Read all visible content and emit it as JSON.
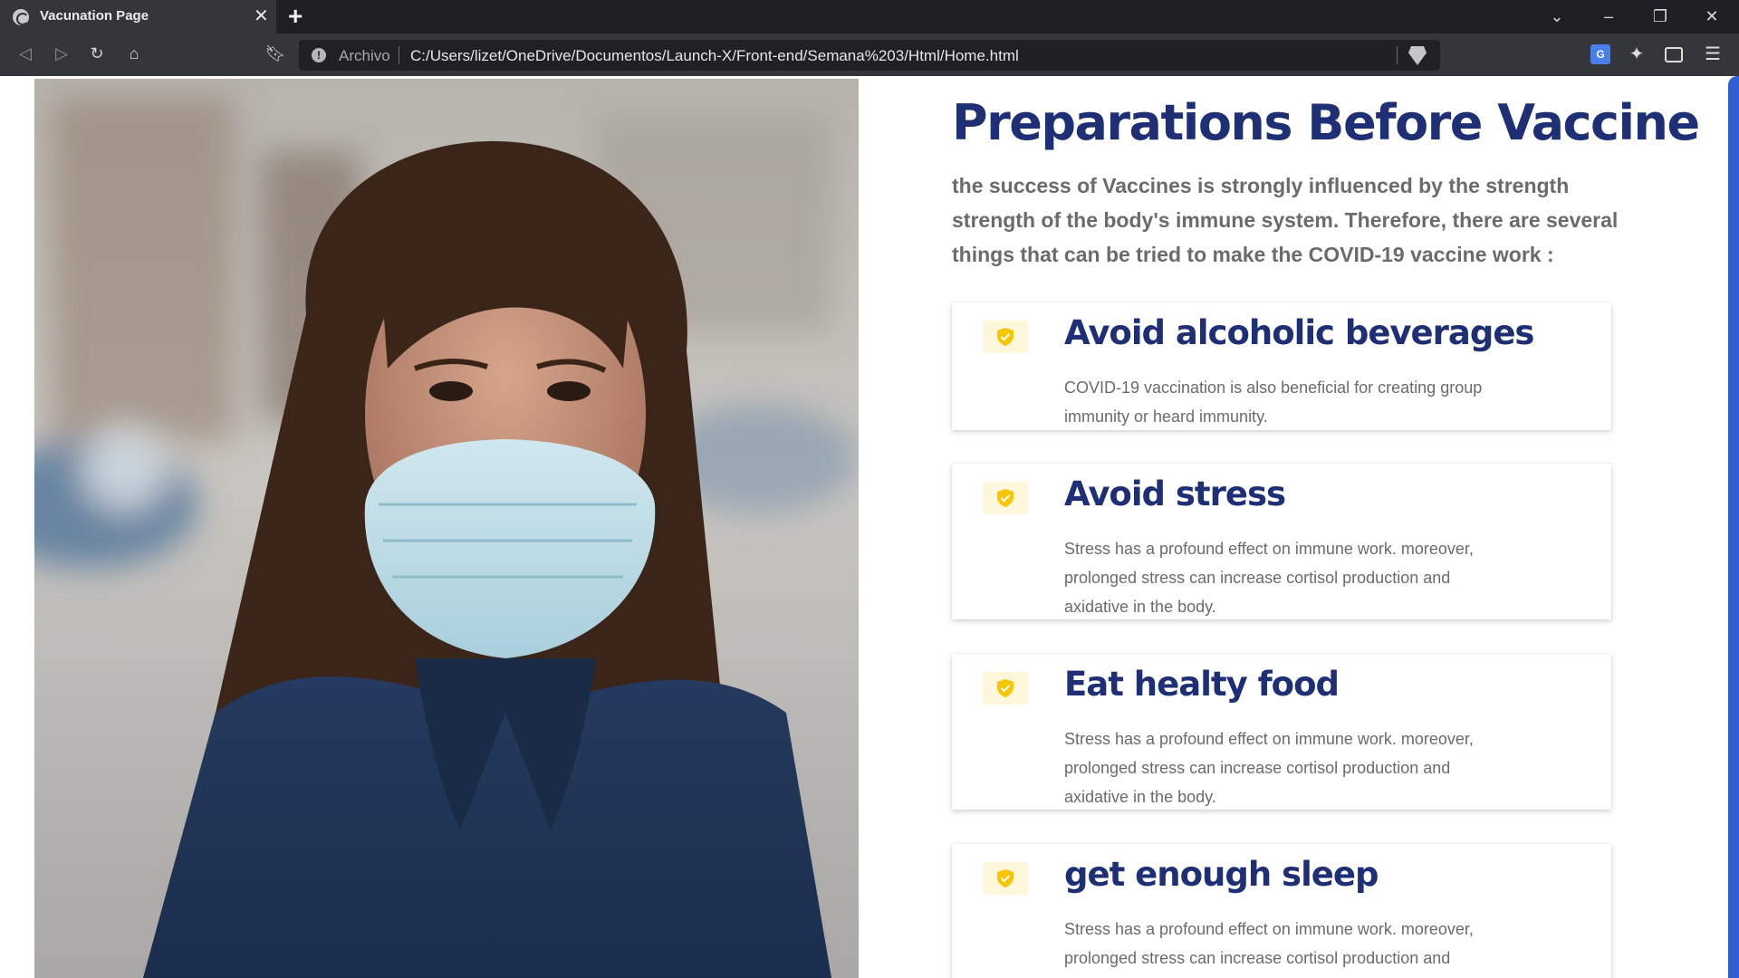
{
  "browser": {
    "tab_title": "Vacunation Page",
    "url_scheme_label": "Archivo",
    "url": "C:/Users/lizet/OneDrive/Documentos/Launch-X/Front-end/Semana%203/Html/Home.html",
    "icons": {
      "tab": "globe-icon",
      "close": "close-icon",
      "new_tab": "plus-icon",
      "back": "back-arrow-icon",
      "forward": "forward-arrow-icon",
      "reload": "reload-icon",
      "home": "home-icon",
      "bookmark": "bookmark-icon",
      "site_info": "info-icon",
      "shields": "brave-shield-icon",
      "translate": "translate-icon",
      "extensions": "puzzle-icon",
      "wallet": "wallet-icon",
      "menu": "hamburger-menu-icon"
    }
  },
  "hero": {
    "image": "woman-wearing-surgical-mask-photo"
  },
  "main": {
    "heading": "Preparations Before Vaccine",
    "intro": "the success of Vaccines is strongly influenced by the strength strength of the body's immune system. Therefore, there are several things that can be tried to make the COVID-19 vaccine work :",
    "cards": [
      {
        "title": "Avoid alcoholic beverages",
        "body": "COVID-19 vaccination is also beneficial for creating group immunity or heard immunity."
      },
      {
        "title": "Avoid stress",
        "body": "Stress has a profound effect on immune work. moreover, prolonged stress can increase cortisol production and axidative in the body."
      },
      {
        "title": "Eat healty food",
        "body": "Stress has a profound effect on immune work. moreover, prolonged stress can increase cortisol production and axidative in the body."
      },
      {
        "title": "get enough sleep",
        "body": "Stress has a profound effect on immune work. moreover, prolonged stress can increase cortisol production and"
      }
    ]
  },
  "colors": {
    "heading": "#1f2f76",
    "body_text": "#6b6b6b",
    "icon_yellow": "#f7c600",
    "icon_bg": "#fff7dc",
    "accent_blue": "#2f5fd0",
    "chrome_dark": "#1e1f24",
    "chrome_tab": "#35363a"
  }
}
